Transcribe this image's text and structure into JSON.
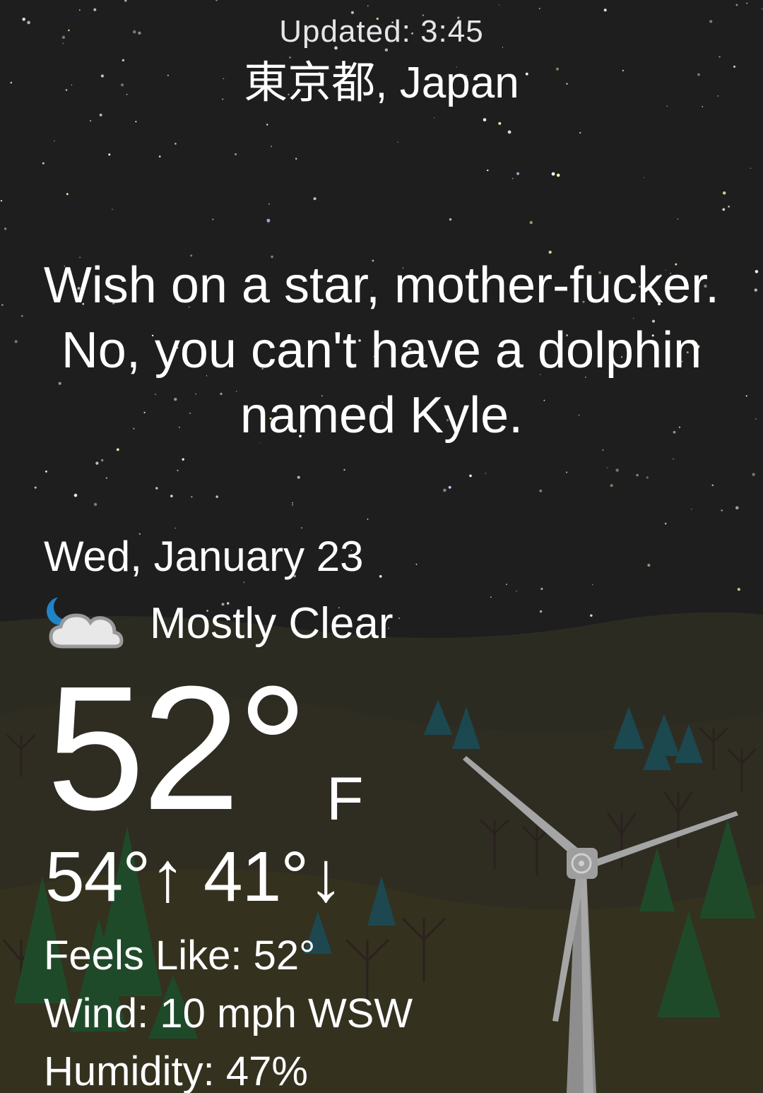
{
  "header": {
    "updated": "Updated: 3:45",
    "location": "東京都, Japan"
  },
  "quote": "Wish on a star, mother-fucker. No, you can't have a dolphin named Kyle.",
  "weather": {
    "date": "Wed, January 23",
    "condition": "Mostly Clear",
    "condition_icon": "moon-cloud-icon",
    "temperature": "52°",
    "unit": "F",
    "high": "54°",
    "high_arrow": "↑",
    "low": "41°",
    "low_arrow": "↓",
    "feels_like": "Feels Like: 52°",
    "wind": "Wind: 10 mph WSW",
    "humidity": "Humidity: 47%"
  },
  "colors": {
    "sky": "#1e1e1e",
    "hills": "#2c2b1f",
    "pine": "#1f4a2a",
    "teal_trees": "#1b4b55",
    "moon": "#1f84c7",
    "turbine": "#9e9e9e"
  }
}
